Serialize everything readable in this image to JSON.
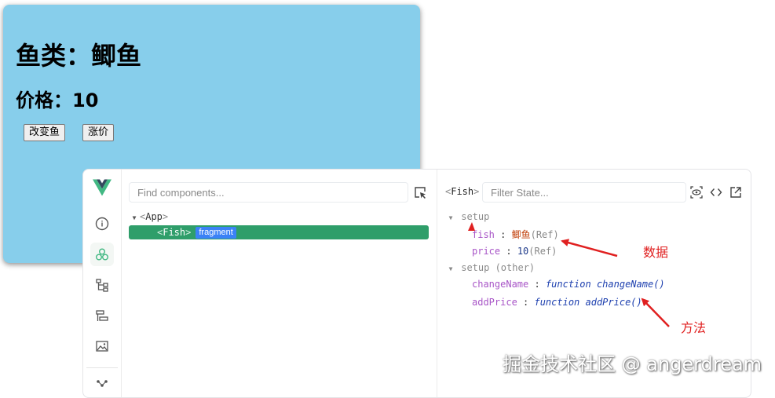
{
  "app": {
    "fish_heading": "鱼类：鲫鱼",
    "price_heading": "价格：10",
    "change_fish_button": "改变鱼",
    "raise_price_button": "涨价"
  },
  "devtools": {
    "logo": "vue-logo-icon",
    "sidebar_icons": [
      "info-icon",
      "components-icon",
      "component-tree-icon",
      "timeline-icon",
      "assets-icon",
      "graph-icon"
    ],
    "component_search_placeholder": "Find components...",
    "tree": {
      "root": "App",
      "child": "Fish",
      "child_badge": "fragment"
    },
    "state": {
      "selected_component": "Fish",
      "filter_placeholder": "Filter State...",
      "setup_section": "setup",
      "setup_other_section": "setup (other)",
      "props": [
        {
          "key": "fish",
          "value": "鲫鱼",
          "meta": "(Ref)"
        },
        {
          "key": "price",
          "value": "10",
          "meta": "(Ref)"
        }
      ],
      "functions": [
        {
          "key": "changeName",
          "value": "function changeName()"
        },
        {
          "key": "addPrice",
          "value": "function addPrice()"
        }
      ]
    }
  },
  "annotations": {
    "data_label": "数据",
    "method_label": "方法",
    "color": "#e02020"
  },
  "watermark": "掘金技术社区 @ angerdream",
  "colors": {
    "card_bg": "#87ceeb",
    "selected_row": "#2f9e6a",
    "badge": "#3b82f6",
    "vue_green": "#42b883"
  }
}
